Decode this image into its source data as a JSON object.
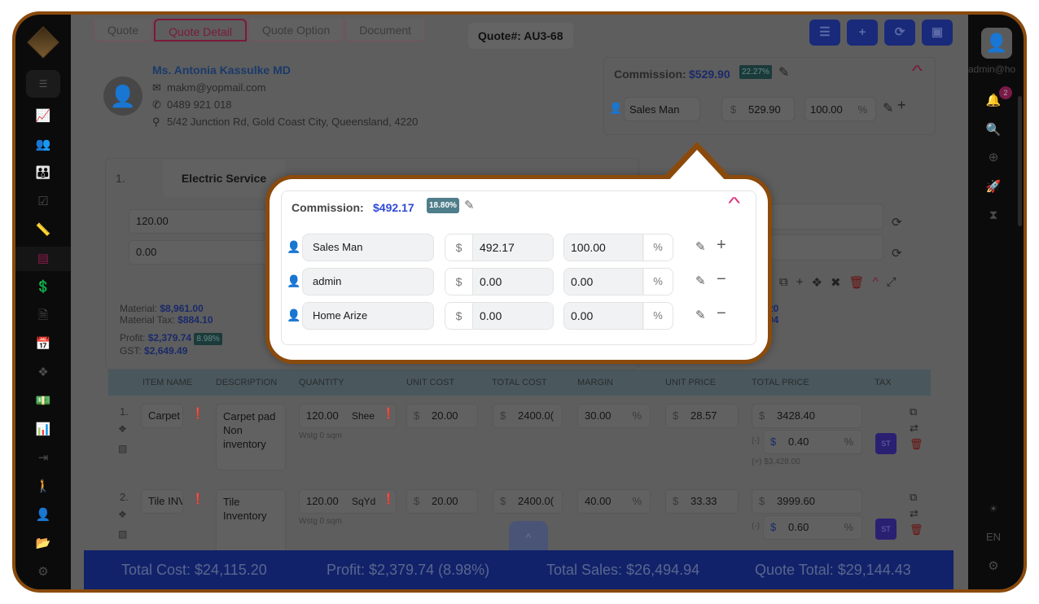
{
  "tabs": [
    {
      "label": "Quote"
    },
    {
      "label": "Quote Detail",
      "active": true
    },
    {
      "label": "Quote Option"
    },
    {
      "label": "Document"
    }
  ],
  "quote_number": "Quote#: AU3-68",
  "toolbar": {
    "buttons": [
      {
        "icon": "sliders-icon",
        "glyph": "☰"
      },
      {
        "icon": "plus-icon",
        "glyph": "+"
      },
      {
        "icon": "refresh-icon",
        "glyph": "⟳"
      },
      {
        "icon": "save-icon",
        "glyph": "▣"
      }
    ]
  },
  "customer": {
    "name": "Ms. Antonia Kassulke MD",
    "email": "makm@yopmail.com",
    "phone": "0489 921 018",
    "address": "5/42 Junction Rd, Gold Coast City, Queensland, 4220"
  },
  "commission_bg": {
    "label": "Commission:",
    "amount": "$529.90",
    "percent": "22.27%",
    "row": {
      "name": "Sales Man",
      "currency": "$",
      "amount": "529.90",
      "percent": "100.00",
      "unit": "%"
    }
  },
  "section": {
    "number": "1.",
    "title": "Electric Service",
    "input1": "120.00",
    "input2": "0.00"
  },
  "totals": {
    "material_label": "Material:",
    "material": "$8,961.00",
    "material_tax_label": "Material Tax:",
    "material_tax": "$884.10",
    "profit_label": "Profit:",
    "profit": "$2,379.74",
    "profit_pct": "8.98%",
    "gst_label": "GST:",
    "gst": "$2,649.49",
    "right_partial1": "20",
    "right_partial2": "94"
  },
  "table": {
    "headers": [
      "ITEM NAME",
      "DESCRIPTION",
      "QUANTITY",
      "UNIT COST",
      "TOTAL COST",
      "MARGIN",
      "UNIT PRICE",
      "TOTAL PRICE",
      "TAX"
    ],
    "rows": [
      {
        "num": "1.",
        "item": "Carpet I",
        "description": "Carpet pad Non inventory",
        "quantity": "120.00",
        "unit": "Shee",
        "wastage": "Wstg  0 sqm",
        "unit_cost": "20.00",
        "total_cost": "2400.0(",
        "margin": "30.00",
        "unit_price": "28.57",
        "total_price": "3428.40",
        "discount": "0.40",
        "discount_prefix": "(-)",
        "net_label": "(=) $3,428.00",
        "tax": "ST"
      },
      {
        "num": "2.",
        "item": "Tile INV",
        "description": "Tile Inventory",
        "quantity": "120.00",
        "unit": "SqYd",
        "wastage": "Wstg  0 sqm",
        "unit_cost": "20.00",
        "total_cost": "2400.0(",
        "margin": "40.00",
        "unit_price": "33.33",
        "total_price": "3999.60",
        "discount": "0.60",
        "discount_prefix": "(-)",
        "net_label": "",
        "tax": "ST"
      }
    ]
  },
  "footer": {
    "total_cost": "Total Cost: $24,115.20",
    "profit": "Profit: $2,379.74 (8.98%)",
    "total_sales": "Total Sales: $26,494.94",
    "quote_total": "Quote Total: $29,144.43"
  },
  "popup": {
    "label": "Commission:",
    "amount": "$492.17",
    "percent": "18.80%",
    "rows": [
      {
        "name": "Sales Man",
        "currency": "$",
        "amount": "492.17",
        "percent": "100.00",
        "unit": "%",
        "action": "+"
      },
      {
        "name": "admin",
        "currency": "$",
        "amount": "0.00",
        "percent": "0.00",
        "unit": "%",
        "action": "−"
      },
      {
        "name": "Home Arize",
        "currency": "$",
        "amount": "0.00",
        "percent": "0.00",
        "unit": "%",
        "action": "−"
      }
    ]
  },
  "right_sidebar": {
    "user": "admin@ho",
    "notifications": "2",
    "language": "EN"
  },
  "colors": {
    "accent_blue": "#2f4ad8",
    "brand_orange": "#8a4a0c",
    "pink": "#e0307a",
    "badge_teal": "#4f7d8a"
  }
}
